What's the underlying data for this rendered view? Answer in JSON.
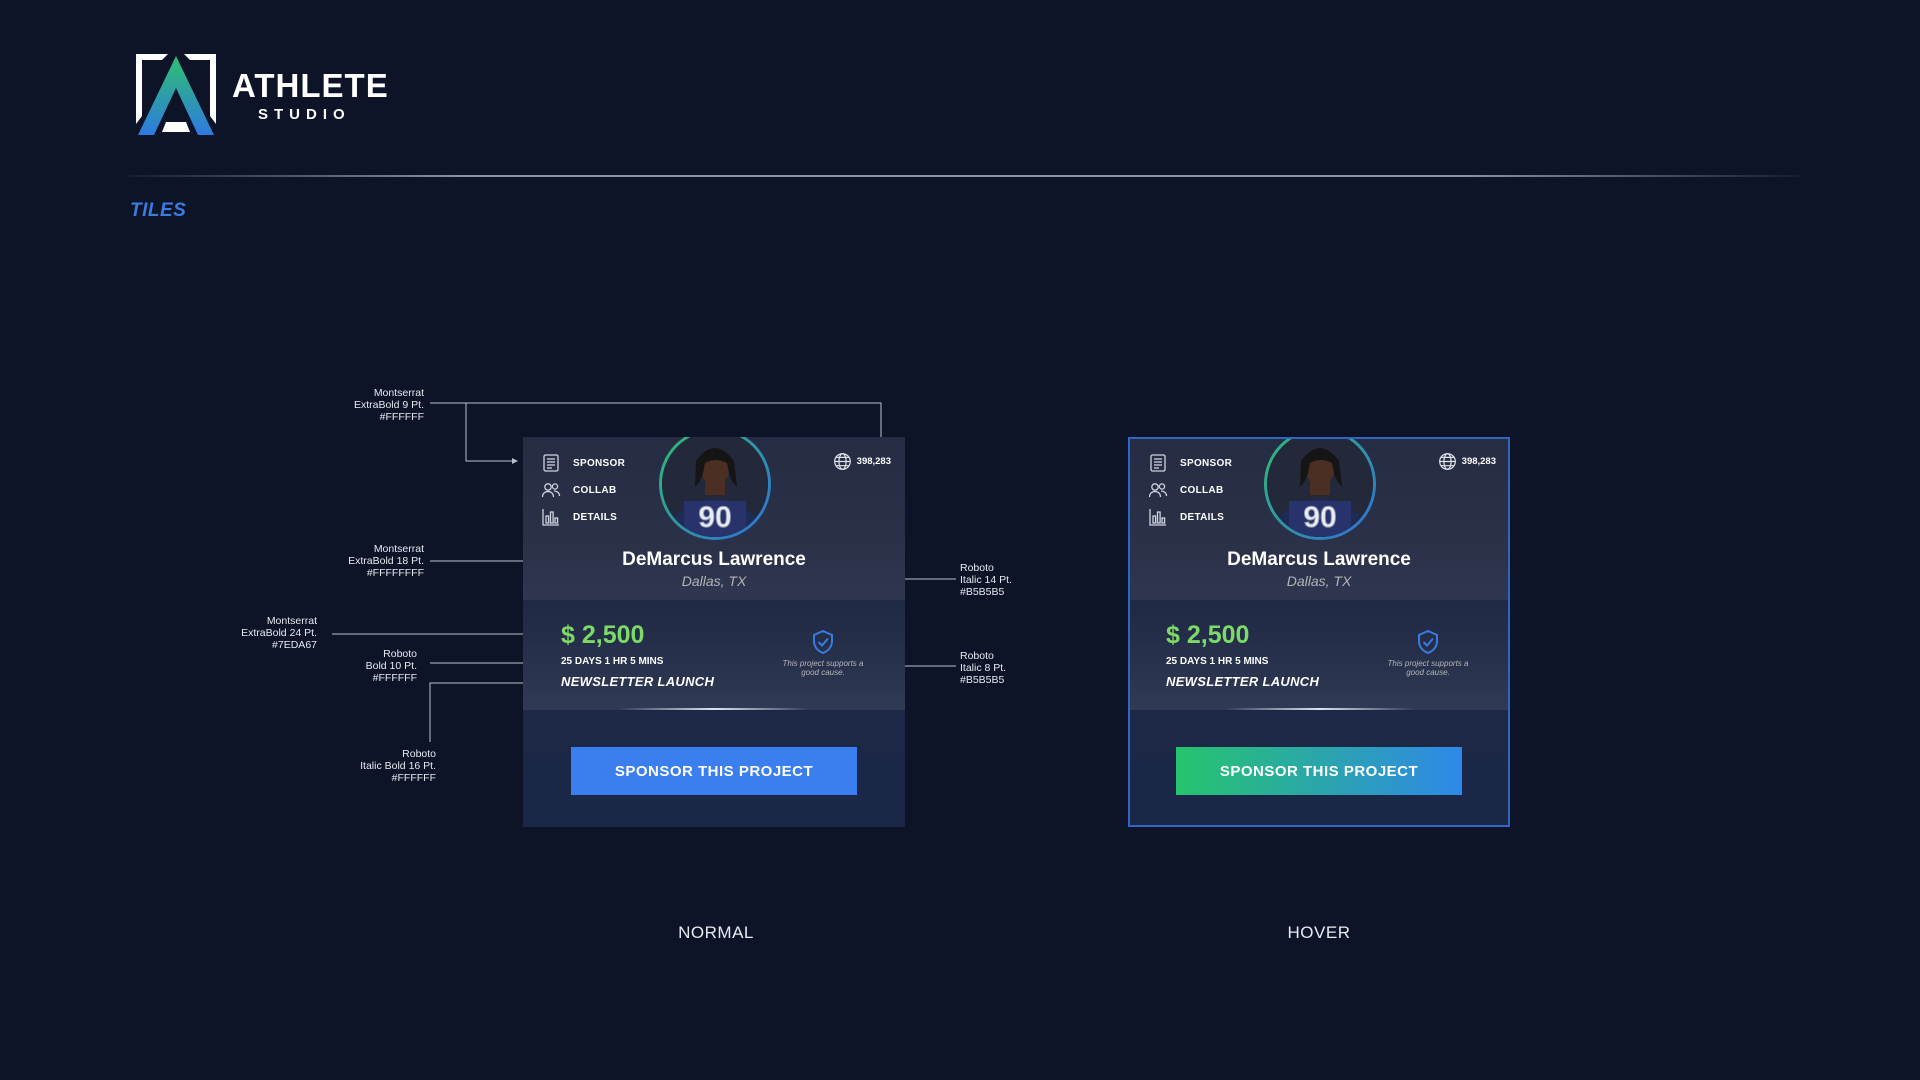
{
  "brand": {
    "name": "ATHLETE",
    "sub": "STUDIO"
  },
  "section": {
    "title": "TILES"
  },
  "annotations": {
    "nav_font": [
      "Montserrat",
      "ExtraBold 9 Pt.",
      "#FFFFFF"
    ],
    "name_font": [
      "Montserrat",
      "ExtraBold 18 Pt.",
      "#FFFFFFFF"
    ],
    "amount_font": [
      "Montserrat",
      "ExtraBold 24 Pt.",
      "#7EDA67"
    ],
    "timer_font": [
      "Roboto",
      "Bold 10 Pt.",
      "#FFFFFF"
    ],
    "project_font": [
      "Roboto",
      "Italic Bold 16 Pt.",
      "#FFFFFF"
    ],
    "city_font": [
      "Roboto",
      "Italic 14 Pt.",
      "#B5B5B5"
    ],
    "cause_font": [
      "Roboto",
      "Italic 8 Pt.",
      "#B5B5B5"
    ]
  },
  "tile": {
    "nav": [
      "SPONSOR",
      "COLLAB",
      "DETAILS"
    ],
    "views": "398,283",
    "athlete_name": "DeMarcus Lawrence",
    "location": "Dallas, TX",
    "jersey_number": "90",
    "amount": "$ 2,500",
    "time_left": "25 DAYS 1 HR 5 MINS",
    "project": "NEWSLETTER LAUNCH",
    "cause_note": "This project supports a good cause.",
    "cta": "SPONSOR THIS PROJECT"
  },
  "states": {
    "normal": "NORMAL",
    "hover": "HOVER"
  },
  "colors": {
    "background": "#0D1428",
    "accent_blue": "#3B7EF0",
    "accent_green": "#7EDA67",
    "hover_gradient": [
      "#26C46E",
      "#2F88E8"
    ],
    "muted_text": "#B5B5B5"
  },
  "icons": {
    "logo": "athlete-studio-logo",
    "sponsor": "document-icon",
    "collab": "users-icon",
    "details": "bar-chart-icon",
    "views": "globe-icon",
    "cause": "shield-check-icon"
  }
}
